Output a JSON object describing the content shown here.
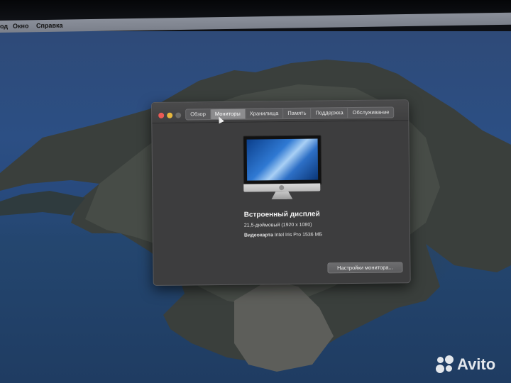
{
  "menubar": {
    "items": [
      "од",
      "Окно",
      "Справка"
    ]
  },
  "window": {
    "tabs": [
      "Обзор",
      "Мониторы",
      "Хранилища",
      "Память",
      "Поддержка",
      "Обслуживание"
    ],
    "active_tab_index": 1,
    "display": {
      "title": "Встроенный дисплей",
      "resolution": "21,5-дюймовый (1920 x 1080)",
      "graphics_label": "Видеокарта",
      "graphics_value": "Intel Iris Pro 1536 МБ"
    },
    "settings_button_label": "Настройки монитора..."
  },
  "watermark": {
    "text": "Avito"
  },
  "colors": {
    "close": "#ec5a55",
    "minimize": "#e6b73d",
    "window_bg": "#3d3d3e",
    "active_tab": "#8c8c8e"
  }
}
